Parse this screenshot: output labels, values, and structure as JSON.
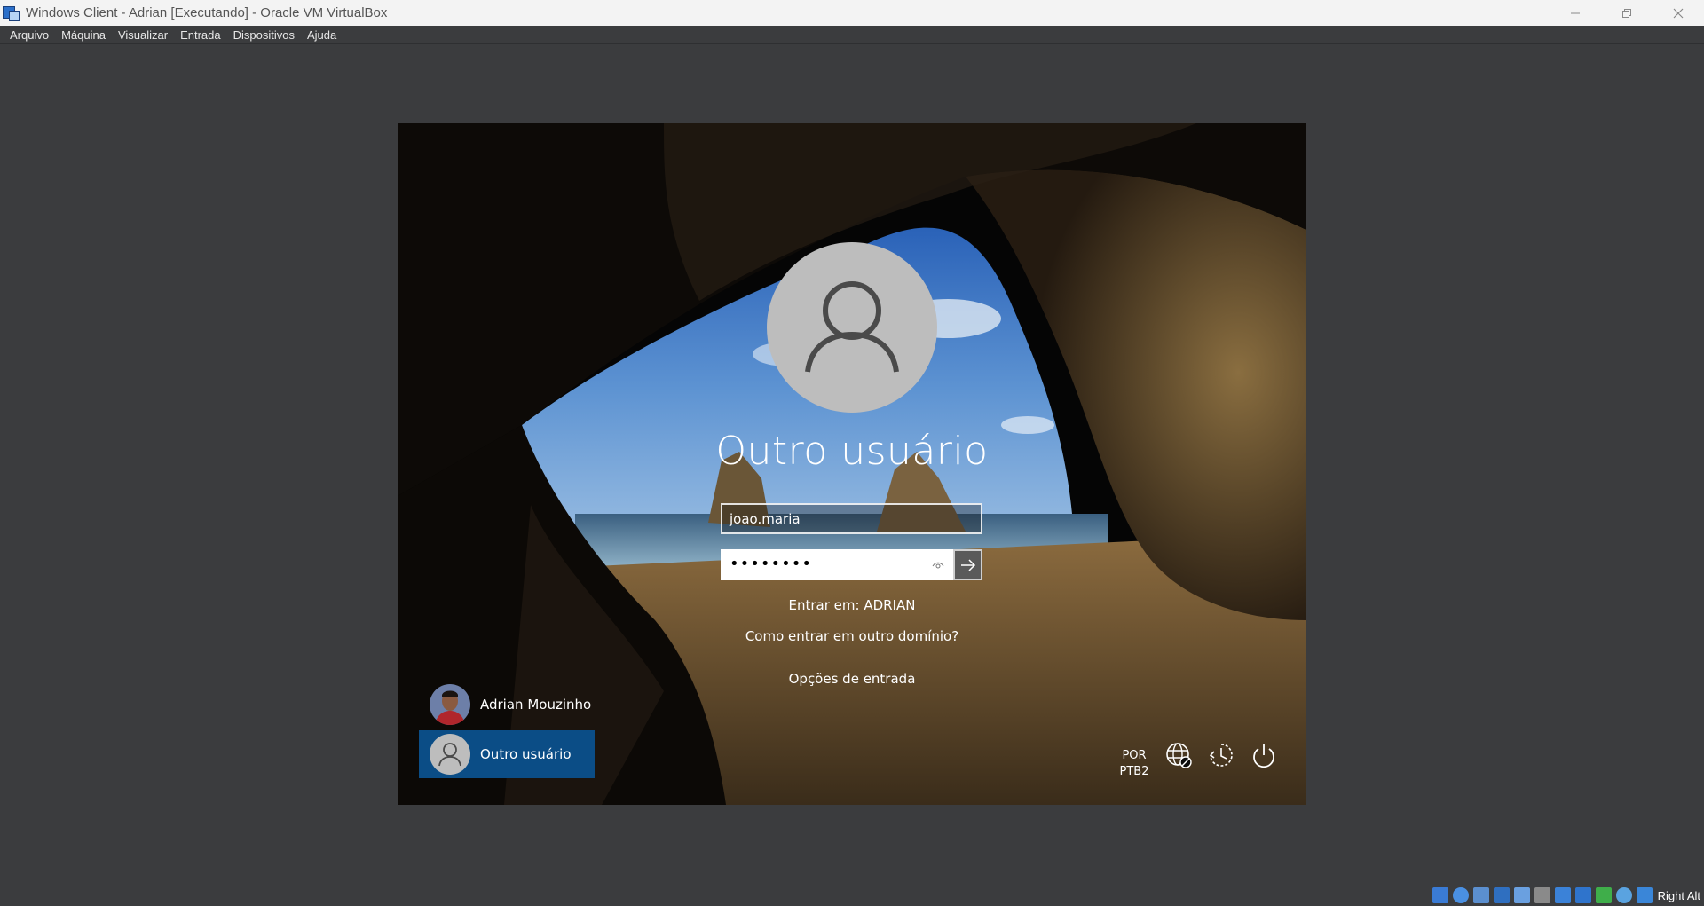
{
  "window": {
    "title": "Windows Client - Adrian [Executando] - Oracle VM VirtualBox",
    "minimize_icon": "minimize-icon",
    "restore_icon": "restore-icon",
    "close_icon": "close-icon"
  },
  "menu": {
    "items": [
      {
        "label": "Arquivo"
      },
      {
        "label": "Máquina"
      },
      {
        "label": "Visualizar"
      },
      {
        "label": "Entrada"
      },
      {
        "label": "Dispositivos"
      },
      {
        "label": "Ajuda"
      }
    ]
  },
  "login": {
    "title": "Outro usuário",
    "username_value": "joao.maria",
    "password_value": "••••••••",
    "sign_in_to": "Entrar em: ADRIAN",
    "domain_link": "Como entrar em outro domínio?",
    "options_link": "Opções de entrada"
  },
  "users": {
    "list": [
      {
        "name": "Adrian Mouzinho"
      },
      {
        "name": "Outro usuário"
      }
    ]
  },
  "tray": {
    "lang_line1": "POR",
    "lang_line2": "PTB2",
    "network_icon": "network-globe-icon",
    "accessibility_icon": "ease-of-access-icon",
    "power_icon": "power-icon"
  },
  "statusbar": {
    "host_key": "Right Alt"
  },
  "colors": {
    "selected_tile": "#0b4d86",
    "chrome_bg": "#3b3c3e"
  }
}
